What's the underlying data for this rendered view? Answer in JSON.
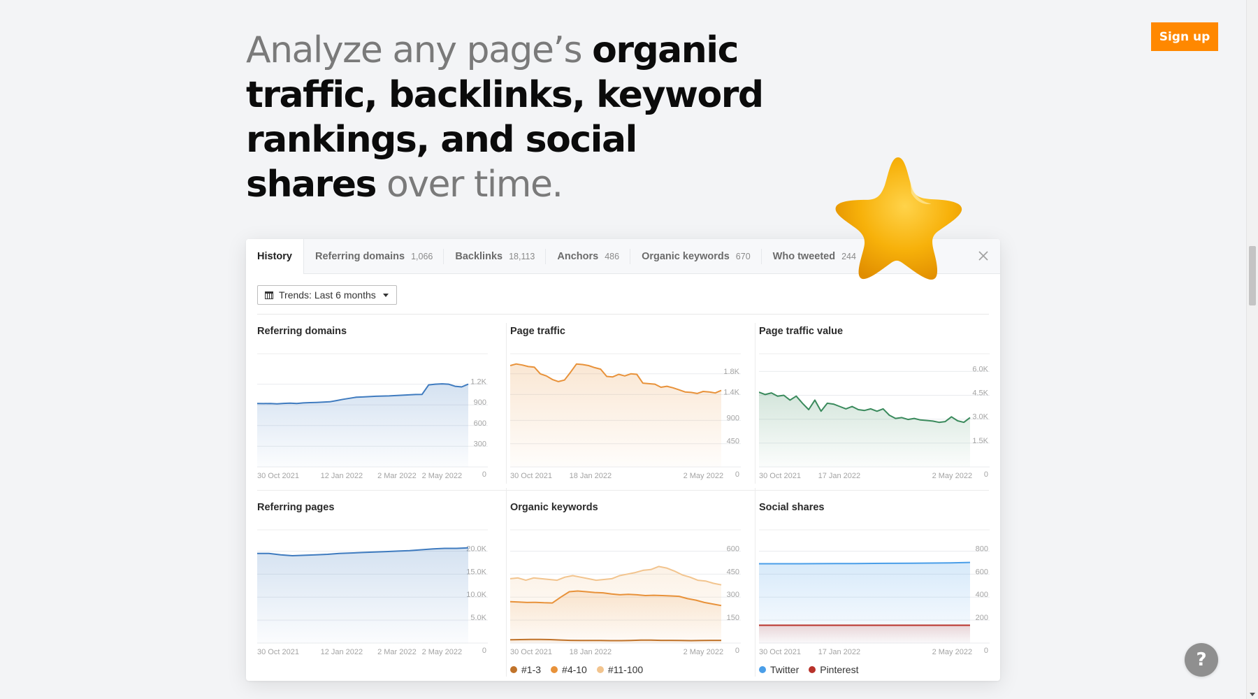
{
  "headline": {
    "part1": "Analyze any page’s ",
    "part2": "organic traffic, backlinks, keyword rankings, and social shares",
    "part3": " over time."
  },
  "signup_label": "Sign up",
  "help_label": "?",
  "tabs": [
    {
      "label": "History",
      "count": "",
      "active": true
    },
    {
      "label": "Referring domains",
      "count": "1,066"
    },
    {
      "label": "Backlinks",
      "count": "18,113"
    },
    {
      "label": "Anchors",
      "count": "486"
    },
    {
      "label": "Organic keywords",
      "count": "670"
    },
    {
      "label": "Who tweeted",
      "count": "244"
    }
  ],
  "close_icon": "×",
  "trends_label": "Trends: Last 6 months",
  "colors": {
    "accent": "#ff8800",
    "blue": "#3f7bbf",
    "orange": "#e8923a",
    "green": "#3a8a5c",
    "kw1": "#c0732a",
    "kw2": "#e8923a",
    "kw3": "#f2c48e",
    "twitter": "#4a9ee8",
    "pinterest": "#b8322a"
  },
  "chart_data": [
    {
      "id": "referring-domains",
      "title": "Referring domains",
      "type": "area",
      "color": "#3f7bbf",
      "ylim": [
        0,
        1500
      ],
      "yticks": [
        {
          "v": 0,
          "l": "0"
        },
        {
          "v": 300,
          "l": "300"
        },
        {
          "v": 600,
          "l": "600"
        },
        {
          "v": 900,
          "l": "900"
        },
        {
          "v": 1200,
          "l": "1.2K"
        }
      ],
      "xticks": [
        {
          "t": 0,
          "l": "30 Oct 2021"
        },
        {
          "t": 0.3,
          "l": "12 Jan 2022"
        },
        {
          "t": 0.57,
          "l": "2 Mar 2022"
        },
        {
          "t": 0.78,
          "l": "2 May 2022"
        }
      ],
      "series": [
        {
          "name": "Referring domains",
          "values": [
            920,
            918,
            920,
            915,
            921,
            925,
            920,
            928,
            932,
            935,
            940,
            945,
            962,
            980,
            995,
            1010,
            1015,
            1020,
            1025,
            1028,
            1030,
            1035,
            1040,
            1045,
            1050,
            1052,
            1190,
            1200,
            1205,
            1200,
            1170,
            1160,
            1200
          ]
        }
      ]
    },
    {
      "id": "page-traffic",
      "title": "Page traffic",
      "type": "area",
      "color": "#e8923a",
      "ylim": [
        0,
        2000
      ],
      "yticks": [
        {
          "v": 0,
          "l": "0"
        },
        {
          "v": 450,
          "l": "450"
        },
        {
          "v": 900,
          "l": "900"
        },
        {
          "v": 1400,
          "l": "1.4K"
        },
        {
          "v": 1800,
          "l": "1.8K"
        }
      ],
      "xticks": [
        {
          "t": 0,
          "l": "30 Oct 2021"
        },
        {
          "t": 0.28,
          "l": "18 Jan 2022"
        },
        {
          "t": 0.82,
          "l": "2 May 2022"
        }
      ],
      "series": [
        {
          "name": "Page traffic",
          "values": [
            1960,
            1990,
            1970,
            1940,
            1930,
            1800,
            1760,
            1690,
            1650,
            1680,
            1830,
            1990,
            1980,
            1960,
            1920,
            1890,
            1750,
            1740,
            1790,
            1760,
            1800,
            1790,
            1620,
            1610,
            1600,
            1540,
            1560,
            1530,
            1490,
            1450,
            1440,
            1420,
            1460,
            1450,
            1430,
            1480
          ]
        }
      ]
    },
    {
      "id": "page-traffic-value",
      "title": "Page traffic value",
      "type": "area",
      "color": "#3a8a5c",
      "ylim": [
        0,
        6500
      ],
      "yticks": [
        {
          "v": 0,
          "l": "0"
        },
        {
          "v": 1500,
          "l": "1.5K"
        },
        {
          "v": 3000,
          "l": "3.0K"
        },
        {
          "v": 4500,
          "l": "4.5K"
        },
        {
          "v": 6000,
          "l": "6.0K"
        }
      ],
      "xticks": [
        {
          "t": 0,
          "l": "30 Oct 2021"
        },
        {
          "t": 0.28,
          "l": "17 Jan 2022"
        },
        {
          "t": 0.82,
          "l": "2 May 2022"
        }
      ],
      "series": [
        {
          "name": "Page traffic value",
          "values": [
            4700,
            4550,
            4650,
            4450,
            4500,
            4200,
            4450,
            4000,
            3600,
            4200,
            3500,
            4000,
            3950,
            3800,
            3650,
            3800,
            3600,
            3550,
            3650,
            3500,
            3650,
            3250,
            3050,
            3100,
            2980,
            3050,
            2950,
            2920,
            2880,
            2800,
            2850,
            3150,
            2900,
            2800,
            3100
          ]
        }
      ]
    },
    {
      "id": "referring-pages",
      "title": "Referring pages",
      "type": "area",
      "color": "#3f7bbf",
      "ylim": [
        0,
        22500
      ],
      "yticks": [
        {
          "v": 0,
          "l": "0"
        },
        {
          "v": 5000,
          "l": "5.0K"
        },
        {
          "v": 10000,
          "l": "10.0K"
        },
        {
          "v": 15000,
          "l": "15.0K"
        },
        {
          "v": 20000,
          "l": "20.0K"
        }
      ],
      "xticks": [
        {
          "t": 0,
          "l": "30 Oct 2021"
        },
        {
          "t": 0.3,
          "l": "12 Jan 2022"
        },
        {
          "t": 0.57,
          "l": "2 Mar 2022"
        },
        {
          "t": 0.78,
          "l": "2 May 2022"
        }
      ],
      "series": [
        {
          "name": "Referring pages",
          "values": [
            19500,
            19500,
            19200,
            19000,
            19100,
            19200,
            19300,
            19500,
            19600,
            19700,
            19800,
            19900,
            20000,
            20100,
            20300,
            20500,
            20600,
            20600,
            20700
          ]
        }
      ]
    },
    {
      "id": "organic-keywords",
      "title": "Organic keywords",
      "type": "area",
      "ylim": [
        0,
        675
      ],
      "yticks": [
        {
          "v": 0,
          "l": "0"
        },
        {
          "v": 150,
          "l": "150"
        },
        {
          "v": 300,
          "l": "300"
        },
        {
          "v": 450,
          "l": "450"
        },
        {
          "v": 600,
          "l": "600"
        }
      ],
      "xticks": [
        {
          "t": 0,
          "l": "30 Oct 2021"
        },
        {
          "t": 0.28,
          "l": "18 Jan 2022"
        },
        {
          "t": 0.82,
          "l": "2 May 2022"
        }
      ],
      "legend": [
        {
          "name": "#1-3",
          "color": "#c0732a"
        },
        {
          "name": "#4-10",
          "color": "#e8923a"
        },
        {
          "name": "#11-100",
          "color": "#f2c48e"
        }
      ],
      "series": [
        {
          "name": "#11-100",
          "color": "#f2c48e",
          "values": [
            420,
            425,
            410,
            425,
            420,
            415,
            410,
            430,
            440,
            430,
            420,
            410,
            415,
            420,
            440,
            450,
            460,
            475,
            480,
            500,
            490,
            470,
            445,
            430,
            410,
            405,
            390,
            380
          ]
        },
        {
          "name": "#4-10",
          "color": "#e8923a",
          "values": [
            270,
            268,
            265,
            266,
            263,
            262,
            300,
            335,
            340,
            335,
            330,
            328,
            320,
            315,
            318,
            315,
            310,
            312,
            310,
            308,
            305,
            290,
            280,
            265,
            255,
            245
          ]
        },
        {
          "name": "#1-3",
          "color": "#c0732a",
          "values": [
            22,
            23,
            24,
            24,
            23,
            20,
            18,
            17,
            17,
            17,
            16,
            16,
            17,
            19,
            19,
            18,
            18,
            17,
            16,
            17,
            18,
            18
          ]
        }
      ]
    },
    {
      "id": "social-shares",
      "title": "Social shares",
      "type": "area",
      "ylim": [
        0,
        900
      ],
      "yticks": [
        {
          "v": 0,
          "l": "0"
        },
        {
          "v": 200,
          "l": "200"
        },
        {
          "v": 400,
          "l": "400"
        },
        {
          "v": 600,
          "l": "600"
        },
        {
          "v": 800,
          "l": "800"
        }
      ],
      "xticks": [
        {
          "t": 0,
          "l": "30 Oct 2021"
        },
        {
          "t": 0.28,
          "l": "17 Jan 2022"
        },
        {
          "t": 0.82,
          "l": "2 May 2022"
        }
      ],
      "legend": [
        {
          "name": "Twitter",
          "color": "#4a9ee8"
        },
        {
          "name": "Pinterest",
          "color": "#b8322a"
        }
      ],
      "series": [
        {
          "name": "Twitter",
          "color": "#4a9ee8",
          "values": [
            690,
            690,
            690,
            691,
            692,
            692,
            693,
            694,
            695,
            696,
            698,
            702
          ]
        },
        {
          "name": "Pinterest",
          "color": "#b8322a",
          "values": [
            155,
            155,
            155,
            155,
            155,
            155,
            155,
            155,
            155,
            155,
            155,
            155
          ]
        }
      ]
    }
  ]
}
